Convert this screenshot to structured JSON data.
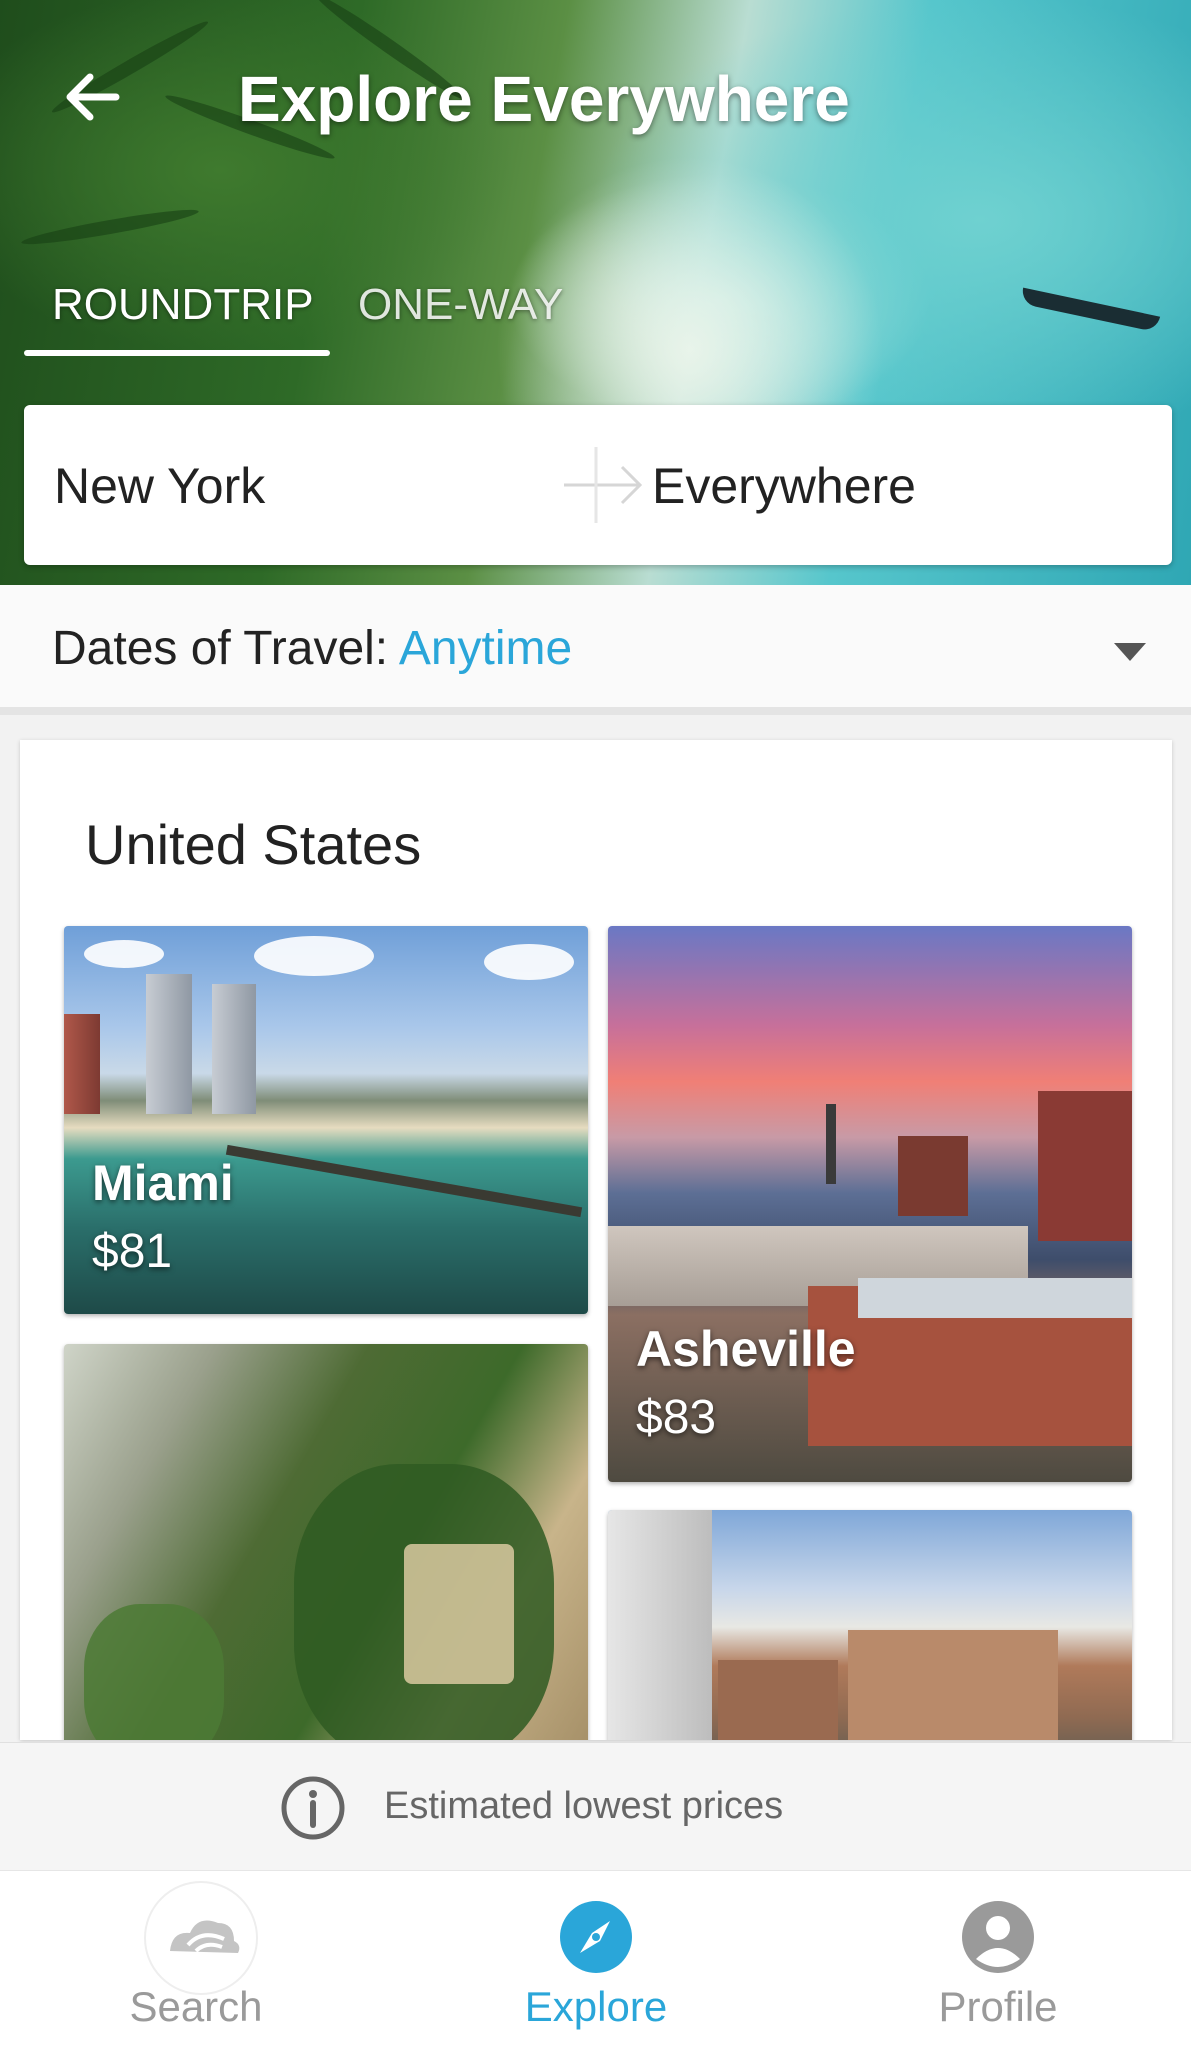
{
  "header": {
    "title": "Explore Everywhere",
    "back_icon": "arrow-left-icon"
  },
  "trip_tabs": [
    {
      "label": "ROUNDTRIP",
      "selected": true
    },
    {
      "label": "ONE-WAY",
      "selected": false
    }
  ],
  "route": {
    "origin": "New York",
    "destination": "Everywhere",
    "arrow_icon": "arrow-right-icon"
  },
  "dates": {
    "label": "Dates of Travel: ",
    "value": "Anytime",
    "dropdown_icon": "chevron-down-icon"
  },
  "section": {
    "title": "United States",
    "destinations": [
      {
        "name": "Miami",
        "price": "$81"
      },
      {
        "name": "Asheville",
        "price": "$83"
      }
    ]
  },
  "info": {
    "text": "Estimated lowest prices",
    "icon": "info-icon"
  },
  "bottom_nav": [
    {
      "label": "Search",
      "icon": "cloud-logo-icon",
      "active": false
    },
    {
      "label": "Explore",
      "icon": "compass-icon",
      "active": true
    },
    {
      "label": "Profile",
      "icon": "profile-icon",
      "active": false
    }
  ],
  "colors": {
    "accent": "#2aa6d9",
    "inactive_nav": "#9a9a9a",
    "text_primary": "#222222"
  }
}
